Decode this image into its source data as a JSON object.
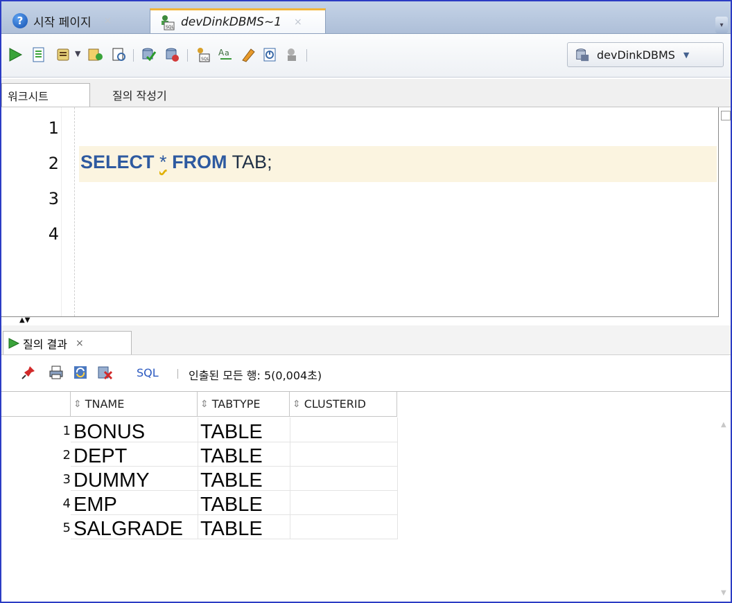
{
  "tabs": [
    {
      "label": "시작 페이지",
      "icon": "help-icon",
      "close": "×"
    },
    {
      "label": "devDinkDBMS~1",
      "icon": "sql-worksheet-icon",
      "close": "×",
      "active": true
    }
  ],
  "toolbar": {
    "connection": "devDinkDBMS"
  },
  "subtabs": {
    "worksheet": "워크시트",
    "query_builder": "질의 작성기"
  },
  "editor": {
    "line_numbers": [
      "1",
      "2",
      "3",
      "4"
    ],
    "code": {
      "kw1": "SELECT",
      "star": "*",
      "kw2": "FROM",
      "rest": "TAB;"
    }
  },
  "results": {
    "tab_label": "질의 결과",
    "tab_close": "×",
    "sql_link": "SQL",
    "status": "인출된 모든 행: 5(0,004초)",
    "columns": [
      "TNAME",
      "TABTYPE",
      "CLUSTERID"
    ],
    "rows": [
      {
        "num": "1",
        "tname": "BONUS",
        "tabtype": "TABLE",
        "clusterid": ""
      },
      {
        "num": "2",
        "tname": "DEPT",
        "tabtype": "TABLE",
        "clusterid": ""
      },
      {
        "num": "3",
        "tname": "DUMMY",
        "tabtype": "TABLE",
        "clusterid": ""
      },
      {
        "num": "4",
        "tname": "EMP",
        "tabtype": "TABLE",
        "clusterid": ""
      },
      {
        "num": "5",
        "tname": "SALGRADE",
        "tabtype": "TABLE",
        "clusterid": ""
      }
    ]
  },
  "colors": {
    "keyword": "#2e5aa0",
    "current_line": "#fbf4e0",
    "active_tab_accent": "#f2b53a"
  }
}
